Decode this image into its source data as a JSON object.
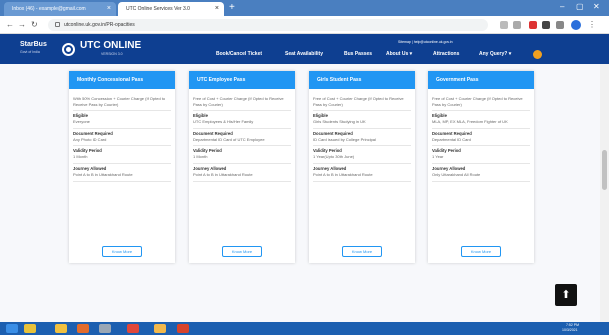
{
  "browser": {
    "tabs": [
      {
        "label": "Inbox (46) - example@gmail.com",
        "active": false
      },
      {
        "label": "UTC Online Services Ver 3.0",
        "active": true
      }
    ],
    "address": "utconline.uk.gov.in/PR-opacities",
    "window_controls": [
      "–",
      "▢",
      "✕"
    ]
  },
  "header": {
    "brand": "StarBus",
    "brand_sub": "Govt of India",
    "title": "UTC ONLINE",
    "version": "VERSION 3.0",
    "top_links": "Sitemap | help@utconline.uk.gov.in",
    "nav": [
      "Book/Cancel Ticket",
      "Seat Availability",
      "Bus Passes",
      "About Us ▾",
      "Attractions",
      "Any Query? ▾"
    ]
  },
  "cards": [
    {
      "title": "Monthly Concessional Pass",
      "desc": "With 50% Concession + Courier Charge (If Opted to Receive Pass by Courier)",
      "eligible_label": "Eligible",
      "eligible": "Everyone",
      "doc_label": "Document Required",
      "doc": "Any Photo ID Card",
      "validity_label": "Validity Period",
      "validity": "1 Month",
      "journey_label": "Journey Allowed",
      "journey": "Point A to B in Uttarakhand Route",
      "button": "Know More"
    },
    {
      "title": "UTC Employee Pass",
      "desc": "Free of Cost + Courier Charge (If Opted to Receive Pass by Courier)",
      "eligible_label": "Eligible",
      "eligible": "UTC Employees & His/Her Family",
      "doc_label": "Document Required",
      "doc": "Departmental ID Card of UTC Employee",
      "validity_label": "Validity Period",
      "validity": "1 Month",
      "journey_label": "Journey Allowed",
      "journey": "Point A to B in Uttarakhand Route",
      "button": "Know More"
    },
    {
      "title": "Girls Student Pass",
      "desc": "Free of Cost + Courier Charge (If Opted to Receive Pass by Courier)",
      "eligible_label": "Eligible",
      "eligible": "Girls Students Studying in UK",
      "doc_label": "Document Required",
      "doc": "ID Card issued by College Principal",
      "validity_label": "Validity Period",
      "validity": "1 Year(Upto 30th June)",
      "journey_label": "Journey Allowed",
      "journey": "Point A to B in Uttarakhand Route",
      "button": "Know More"
    },
    {
      "title": "Government Pass",
      "desc": "Free of Cost + Courier Charge (If Opted to Receive Pass by Courier)",
      "eligible_label": "Eligible",
      "eligible": "MLA, MP, EX MLA, Freedom Fighter of UK",
      "doc_label": "Document Required",
      "doc": "Departmental ID Card",
      "validity_label": "Validity Period",
      "validity": "1 Year",
      "journey_label": "Journey Allowed",
      "journey": "Only Uttarakhand All Route",
      "button": "Know More"
    }
  ],
  "back_to_top": "⬆",
  "taskbar": {
    "time": "7:52 PM",
    "date": "10/3/2021"
  },
  "colors": {
    "header": "#0e3f91",
    "card_head": "#2196f3",
    "taskbar": "#1c5fb0"
  }
}
